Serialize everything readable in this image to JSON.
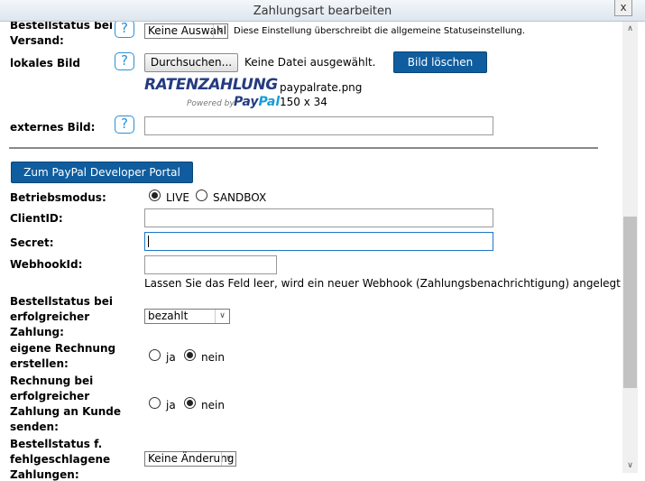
{
  "window": {
    "title": "Zahlungsart bearbeiten",
    "close_label": "x"
  },
  "fields": {
    "bestellstatus_versand": {
      "label_line1": "Bestellstatus bei",
      "label_line2": "Versand:",
      "value": "Keine Auswahl",
      "note": "Diese Einstellung überschreibt die allgemeine Statuseinstellung."
    },
    "lokales_bild": {
      "label": "lokales Bild",
      "browse_label": "Durchsuchen...",
      "file_status": "Keine Datei ausgewählt.",
      "delete_label": "Bild löschen",
      "image_name": "paypalrate.png",
      "image_size": "150 x 34"
    },
    "logo": {
      "brand_text": "RATENZAHLUNG",
      "powered_text": "Powered by",
      "paypal_pay": "Pay",
      "paypal_pal": "Pal"
    },
    "externes_bild": {
      "label": "externes Bild:",
      "value": ""
    },
    "portal_button": "Zum PayPal Developer Portal",
    "betriebsmodus": {
      "label": "Betriebsmodus:",
      "options": [
        "LIVE",
        "SANDBOX"
      ],
      "selected": "LIVE"
    },
    "client_id": {
      "label": "ClientID:",
      "value": ""
    },
    "secret": {
      "label": "Secret:",
      "value": ""
    },
    "webhook_id": {
      "label": "WebhookId:",
      "value": "",
      "hint": "Lassen Sie das Feld leer, wird ein neuer Webhook (Zahlungsbenachrichtigung) angelegt"
    },
    "bestellstatus_erfolg": {
      "label_line1": "Bestellstatus bei",
      "label_line2": "erfolgreicher",
      "label_line3": "Zahlung:",
      "value": "bezahlt"
    },
    "eigene_rechnung": {
      "label_line1": "eigene Rechnung",
      "label_line2": "erstellen:",
      "options": [
        "ja",
        "nein"
      ],
      "selected": "nein"
    },
    "rechnung_kunde": {
      "label_line1": "Rechnung bei",
      "label_line2": "erfolgreicher",
      "label_line3": "Zahlung an Kunde",
      "label_line4": "senden:",
      "options": [
        "ja",
        "nein"
      ],
      "selected": "nein"
    },
    "bestellstatus_fehl": {
      "label_line1": "Bestellstatus f.",
      "label_line2": "fehlgeschlagene",
      "label_line3": "Zahlungen:",
      "value": "Keine Änderung"
    }
  },
  "help_glyph": "?",
  "icons": {
    "help": "help-icon",
    "dropdown": "chevron-down-icon",
    "close": "close-icon"
  },
  "colors": {
    "accent": "#0f5d9f",
    "help": "#2c8fd6",
    "paypal_dark": "#253b80",
    "paypal_light": "#179bd7"
  }
}
